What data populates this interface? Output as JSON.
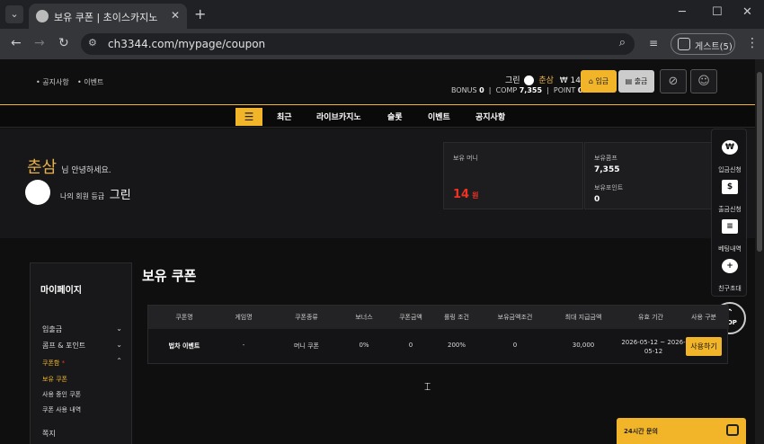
{
  "browser": {
    "tab_title": "보유 쿠폰 | 초이스카지노",
    "url": "ch3344.com/mypage/coupon",
    "profile_label": "게스트(5)",
    "new_tab": "+",
    "tab_close": "✕"
  },
  "header": {
    "links": [
      "공지사항",
      "이벤트"
    ],
    "level_name": "그린",
    "username": "춘삼",
    "balance": "₩ 14",
    "bonus_label": "BONUS",
    "bonus_value": "0",
    "comp_label": "COMP",
    "comp_value": "7,355",
    "point_label": "POINT",
    "point_value": "0",
    "deposit_label": "입금",
    "withdraw_label": "출금"
  },
  "menu": {
    "items": [
      "최근",
      "라이브카지노",
      "슬롯",
      "이벤트",
      "공지사항"
    ]
  },
  "hero": {
    "name": "춘삼",
    "greeting": "님 안녕하세요.",
    "grade_label": "나의 회원 등급",
    "grade_name": "그린",
    "money_label": "보유 머니",
    "money_value": "14",
    "money_unit": "원",
    "comp_label": "보유콤프",
    "comp_value": "7,355",
    "point_label": "보유포인트",
    "point_value": "0"
  },
  "float_menu": {
    "items": [
      "입금신청",
      "출금신청",
      "베팅내역",
      "친구초대"
    ],
    "top_label": "TOP"
  },
  "leftnav": {
    "title": "마이페이지",
    "items": [
      "입출금",
      "콤프 & 포인트",
      "쿠폰함"
    ],
    "coupon_subs": [
      "보유 쿠폰",
      "사용 중인 쿠폰",
      "쿠폰 사용 내역"
    ],
    "last_item": "쪽지",
    "new_mark": "*"
  },
  "content": {
    "title": "보유 쿠폰",
    "columns": [
      "쿠폰명",
      "게임명",
      "쿠폰종류",
      "보너스",
      "쿠폰금액",
      "롤링 조건",
      "보유금액조건",
      "최대 지급금액",
      "유효 기간",
      "사용 구분"
    ],
    "rows": [
      {
        "name": "법차 이벤트",
        "game": "-",
        "type": "머니 쿠폰",
        "bonus": "0%",
        "amount": "0",
        "rolling": "200%",
        "hold_condition": "0",
        "max_payout": "30,000",
        "period": "2026-05-12 ~ 2026-05-12",
        "action": "사용하기"
      }
    ]
  },
  "chat": {
    "label": "24시간 문의"
  },
  "colors": {
    "accent": "#f2b529",
    "name": "#e7b04a",
    "money": "#e33322",
    "bg": "#0f0f10"
  }
}
